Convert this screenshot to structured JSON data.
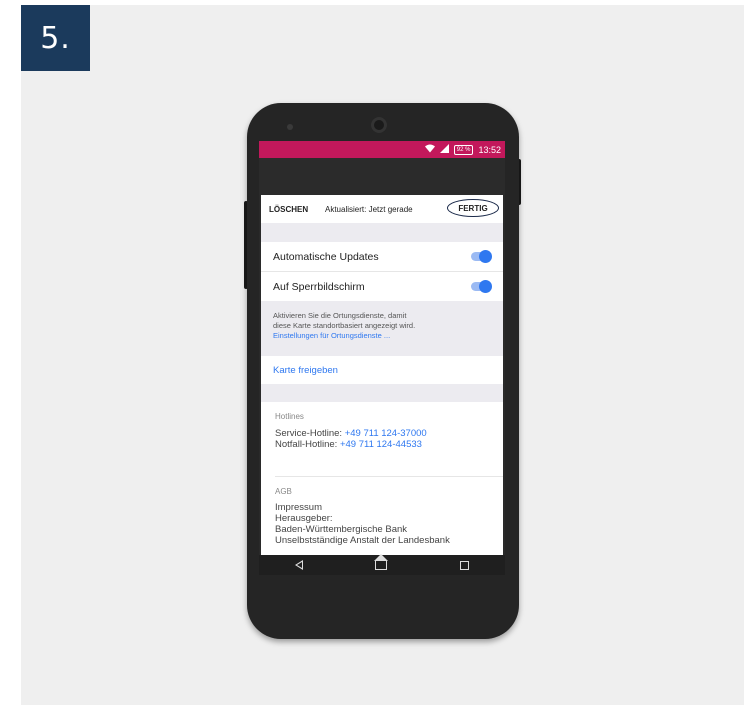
{
  "step": {
    "label": "5."
  },
  "status_bar": {
    "battery": "92 %",
    "time": "13:52",
    "wifi_icon": "wifi-icon",
    "signal_icon": "signal-icon"
  },
  "toolbar": {
    "delete_label": "LÖSCHEN",
    "updated_label": "Aktualisiert: Jetzt gerade",
    "done_label": "FERTIG"
  },
  "settings": {
    "auto_updates_label": "Automatische Updates",
    "lock_screen_label": "Auf Sperrbildschirm",
    "auto_updates_on": true,
    "lock_screen_on": true
  },
  "location_info": {
    "line1": "Aktivieren Sie die Ortungsdienste, damit",
    "line2": "diese Karte standortbasiert angezeigt wird.",
    "link": "Einstellungen für Ortungsdienste ..."
  },
  "share": {
    "label": "Karte freigeben"
  },
  "hotlines": {
    "header": "Hotlines",
    "service_label": "Service-Hotline: ",
    "service_number": "+49 711 124-37000",
    "emergency_label": "Notfall-Hotline: ",
    "emergency_number": "+49 711 124-44533"
  },
  "agb": {
    "header": "AGB",
    "line1": "Impressum",
    "line2": "Herausgeber:",
    "line3": "Baden-Württembergische Bank",
    "line4": "Unselbstständige Anstalt der Landesbank"
  },
  "colors": {
    "status_bar": "#c2185b",
    "accent": "#2f78f0",
    "badge": "#1b3a5c"
  }
}
